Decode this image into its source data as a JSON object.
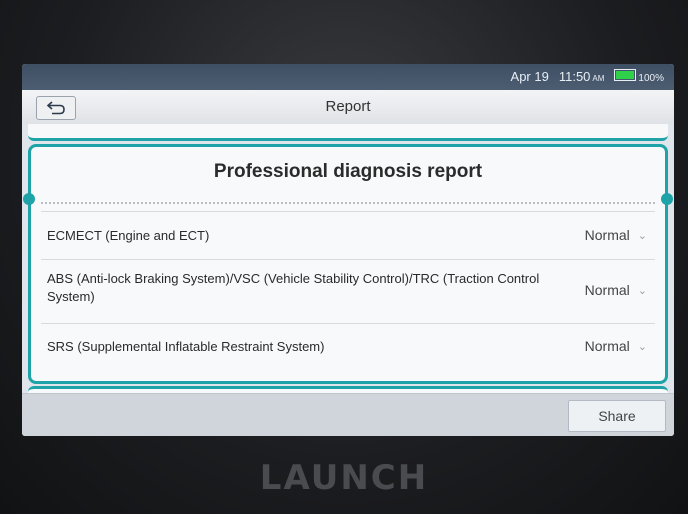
{
  "status_bar": {
    "date": "Apr 19",
    "time": "11:50",
    "ampm": "AM",
    "battery_percent": "100%",
    "battery_level": 1.0
  },
  "header": {
    "title": "Report"
  },
  "report": {
    "title": "Professional diagnosis report",
    "items": [
      {
        "label": "ECMECT (Engine and ECT)",
        "status": "Normal"
      },
      {
        "label": "ABS (Anti-lock Braking System)/VSC (Vehicle Stability Control)/TRC (Traction Control System)",
        "status": "Normal"
      },
      {
        "label": "SRS (Supplemental Inflatable Restraint System)",
        "status": "Normal"
      }
    ]
  },
  "footer": {
    "share_label": "Share"
  },
  "device": {
    "brand": "LAUNCH"
  },
  "colors": {
    "accent": "#1da3a8",
    "battery": "#2fd04a"
  }
}
